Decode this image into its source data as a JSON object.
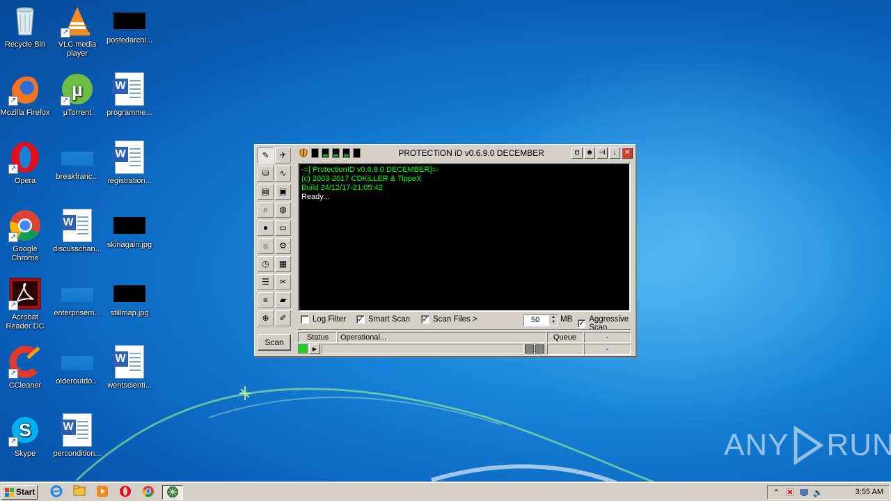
{
  "desktop": {
    "icons": [
      {
        "label": "Recycle Bin",
        "icon": "recycle-bin-icon"
      },
      {
        "label": "VLC media player",
        "icon": "vlc-icon"
      },
      {
        "label": "postedarchi...",
        "icon": "image-file-icon"
      },
      {
        "label": "Mozilla Firefox",
        "icon": "firefox-icon"
      },
      {
        "label": "µTorrent",
        "icon": "utorrent-icon"
      },
      {
        "label": "programme...",
        "icon": "word-document-icon"
      },
      {
        "label": "Opera",
        "icon": "opera-icon"
      },
      {
        "label": "breakfranc...",
        "icon": "blank-file-icon"
      },
      {
        "label": "registration...",
        "icon": "word-document-icon"
      },
      {
        "label": "Google Chrome",
        "icon": "chrome-icon"
      },
      {
        "label": "discusschan...",
        "icon": "word-document-icon"
      },
      {
        "label": "skinagain.jpg",
        "icon": "image-file-icon"
      },
      {
        "label": "Acrobat Reader DC",
        "icon": "acrobat-icon"
      },
      {
        "label": "enterprisem...",
        "icon": "blank-file-icon"
      },
      {
        "label": "stillmap.jpg",
        "icon": "image-file-icon"
      },
      {
        "label": "CCleaner",
        "icon": "ccleaner-icon"
      },
      {
        "label": "olderoutdo...",
        "icon": "blank-file-icon"
      },
      {
        "label": "wentscienti...",
        "icon": "word-document-icon"
      },
      {
        "label": "Skype",
        "icon": "skype-icon"
      },
      {
        "label": "percondition...",
        "icon": "word-document-icon"
      }
    ]
  },
  "window": {
    "title": "PROTECTiON iD v0.6.9.0 DECEMBER",
    "console_lines": [
      {
        "text": "-=[ ProtectionID v0.6.9.0 DECEMBER]=-",
        "color": "#00ff00"
      },
      {
        "text": "(c) 2003-2017 CDKiLLER & TippeX",
        "color": "#00ff00"
      },
      {
        "text": "Build 24/12/17-21:05:42",
        "color": "#00ff00"
      },
      {
        "text": "Ready...",
        "color": "#ffffff"
      }
    ],
    "options": {
      "log_filter": {
        "label": "Log Filter",
        "checked": false
      },
      "smart_scan": {
        "label": "Smart Scan",
        "checked": true
      },
      "scan_files": {
        "label": "Scan Files >",
        "checked": true
      },
      "size_value": "50",
      "size_unit": "MB",
      "aggressive_scan": {
        "label": "Aggressive Scan",
        "checked": true
      }
    },
    "status": {
      "status_label": "Status",
      "status_text": "Operational...",
      "queue_label": "Queue",
      "queue_value_1": "-",
      "queue_value_2": "-"
    },
    "progress": 0,
    "scan_button": "Scan",
    "check_mark": "✓"
  },
  "taskbar": {
    "start_label": "Start",
    "clock": "3:55 AM"
  },
  "watermark": {
    "left": "ANY",
    "right": "RUN"
  }
}
